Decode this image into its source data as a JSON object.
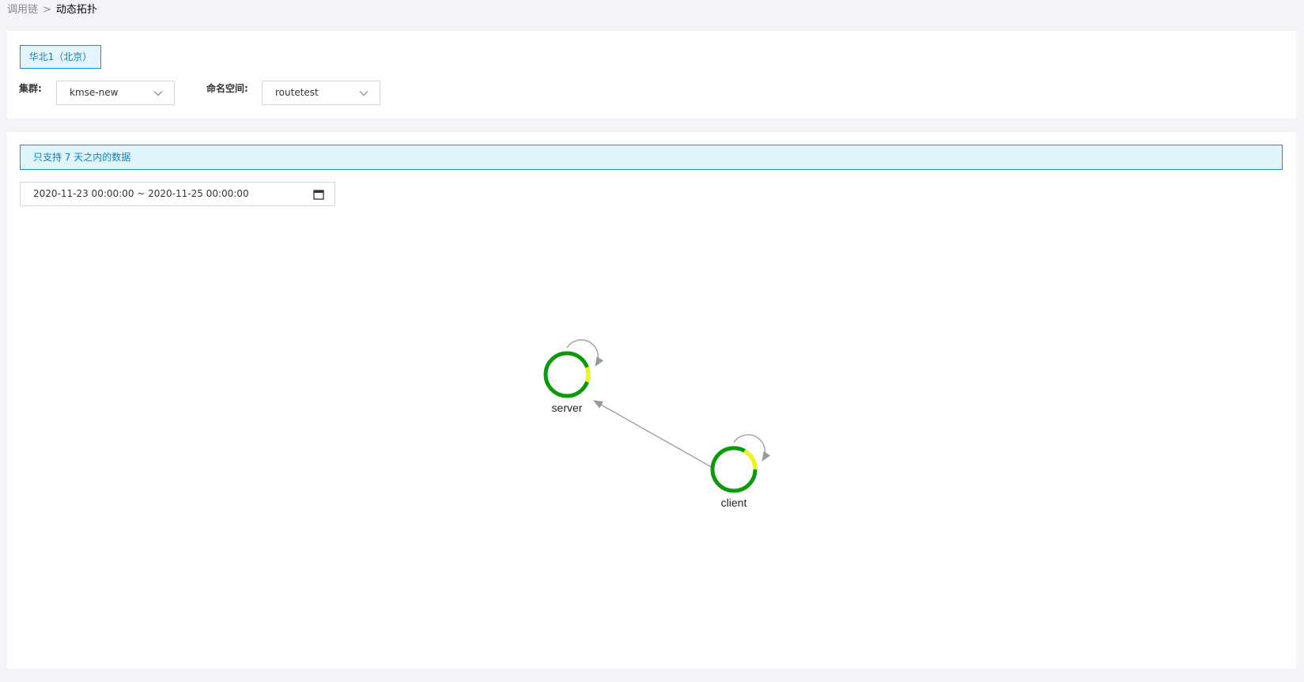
{
  "breadcrumb": {
    "parent": "调用链",
    "separator": ">",
    "current": "动态拓扑"
  },
  "filters": {
    "region_button": "华北1（北京）",
    "cluster_label": "集群:",
    "cluster_value": "kmse-new",
    "namespace_label": "命名空间:",
    "namespace_value": "routetest"
  },
  "main": {
    "notice": "只支持 7 天之内的数据",
    "date_range": "2020-11-23 00:00:00 ~ 2020-11-25 00:00:00",
    "calendar_icon": "calendar-icon"
  },
  "topology": {
    "nodes": [
      {
        "id": "server",
        "label": "server",
        "success_ratio": 0.92,
        "self_call": true
      },
      {
        "id": "client",
        "label": "client",
        "success_ratio": 0.84,
        "self_call": true
      }
    ],
    "edges": [
      {
        "from": "client",
        "to": "server"
      }
    ],
    "colors": {
      "success": "#0a9a0a",
      "warning": "#f5f50a",
      "edge": "#999999",
      "accent": "#1b8dc6"
    }
  }
}
